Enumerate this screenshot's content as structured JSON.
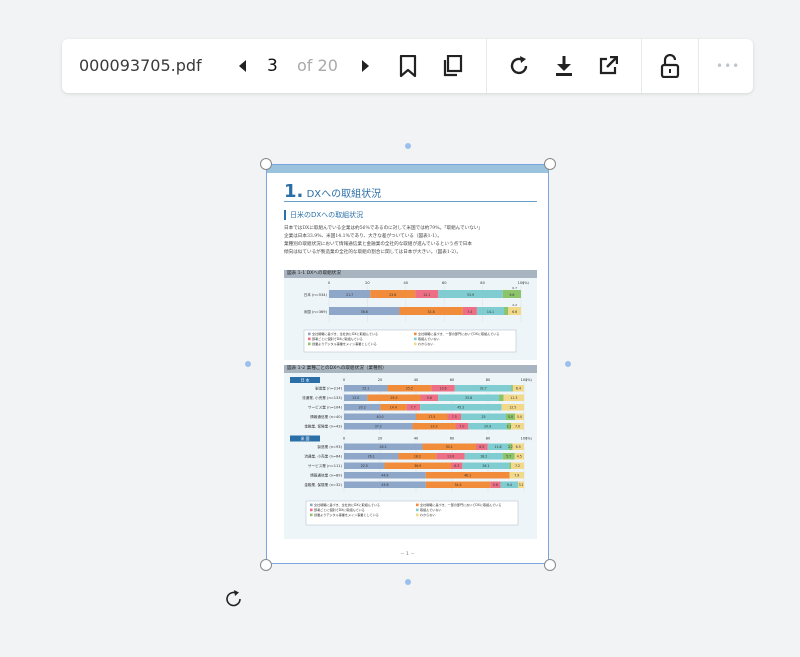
{
  "toolbar": {
    "filename": "000093705.pdf",
    "current_page": "3",
    "page_total": "of 20",
    "more": "•••"
  },
  "document": {
    "chapter_num": "1.",
    "chapter_title": "DXへの取組状況",
    "section_title": "日米のDXへの取組状況",
    "body": [
      "日本ではDXに取組んでいる企業は約56%であるのに対して米国では約79%。「取組んでいない」",
      "企業は日本33.9%、米国14.1%であり、大きな差がついている（図表1-1）。",
      "業種別の取組状況において情報通信業と金融業の全社的な取組が進んでいるという点で日本",
      "傾向は似ているが製造業の全社的な取組の割合に関しては日本が大きい。（図表1-2）。"
    ],
    "footer": "－ 1 －"
  },
  "fig1": {
    "title": "図表 1-1 DXへの取組状況",
    "unit": "(%)",
    "ticks": [
      "0",
      "20",
      "40",
      "60",
      "80",
      "100"
    ],
    "rows": [
      {
        "label": "日本 (n=534)",
        "values": [
          21.7,
          23.6,
          12.1,
          33.9,
          9.6,
          0
        ],
        "labels": [
          "21.7",
          "23.6",
          "12.1",
          "33.9",
          "9.6"
        ],
        "note": "0.7"
      },
      {
        "label": "米国 (n=369)",
        "values": [
          36.6,
          32.8,
          7.4,
          14.1,
          2.2,
          6.6
        ],
        "labels": [
          "36.6",
          "32.8",
          "7.4",
          "14.1",
          "",
          "6.6"
        ],
        "note": "2.2"
      }
    ],
    "legend": [
      "全社戦略に基づき、全社的にDXに取組んでいる",
      "全社戦略に基づき、一部の部門においてDXに取組んでいる",
      "部署ごとに個別でDXに取組んでいる",
      "取組んでいない",
      "創業よりデジタル事業をメイン事業としている",
      "わからない"
    ]
  },
  "fig2": {
    "title": "図表 1-2 業種ごとのDXへの取組状況（業種別）",
    "unit": "(%)",
    "ticks": [
      "0",
      "20",
      "40",
      "60",
      "80",
      "100"
    ],
    "groups": [
      {
        "name": "日 本",
        "rows": [
          {
            "label": "製造業 (n=214)",
            "values": [
              25.1,
              25.2,
              13.6,
              32.7,
              0.8,
              6.4
            ],
            "labels": [
              "25.1",
              "25.2",
              "13.6",
              "32.7",
              "0.8",
              "6.4"
            ]
          },
          {
            "label": "流通業, 小売業 (n=133)",
            "values": [
              13.0,
              29.5,
              9.8,
              33.8,
              2.6,
              11.3
            ],
            "labels": [
              "13.0",
              "29.5",
              "9.8",
              "33.8",
              "",
              "11.3"
            ]
          },
          {
            "label": "サービス業 (n=104)",
            "values": [
              20.2,
              14.4,
              7.7,
              45.2,
              0,
              12.5
            ],
            "labels": [
              "20.2",
              "14.4",
              "7.7",
              "45.2",
              "",
              "12.5"
            ]
          },
          {
            "label": "情報通信業 (n=40)",
            "values": [
              40.0,
              17.5,
              7.5,
              25.0,
              5.0,
              5.0
            ],
            "labels": [
              "40.0",
              "17.5",
              "7.5",
              "25",
              "5.0",
              "5.0"
            ]
          },
          {
            "label": "金融業, 保険業 (n=43)",
            "values": [
              37.2,
              23.3,
              7.0,
              20.9,
              2.3,
              7.0
            ],
            "labels": [
              "37.2",
              "23.3",
              "7.0",
              "20.9",
              "2.3",
              "7.0"
            ]
          }
        ]
      },
      {
        "name": "米 国",
        "rows": [
          {
            "label": "製造業 (n=93)",
            "values": [
              44.1,
              30.1,
              6.5,
              11.8,
              2.2,
              6.5
            ],
            "labels": [
              "44.1",
              "30.1",
              "6.5",
              "11.8",
              "2.2",
              "6.5"
            ]
          },
          {
            "label": "流通業, 小売業 (n=64)",
            "values": [
              26.1,
              18.2,
              13.6,
              18.2,
              5.7,
              4.5
            ],
            "labels": [
              "26.1",
              "18.2",
              "13.6",
              "18.2",
              "5.7",
              "4.5"
            ]
          },
          {
            "label": "サービス業 (n=111)",
            "values": [
              22.5,
              36.9,
              6.3,
              26.1,
              0.9,
              7.2
            ],
            "labels": [
              "22.5",
              "36.9",
              "6.3",
              "26.1",
              "0.9",
              "7.2"
            ]
          },
          {
            "label": "情報通信業 (n=89)",
            "values": [
              44.9,
              46.1,
              0,
              0,
              0,
              7.9
            ],
            "labels": [
              "44.9",
              "46.1",
              "",
              "",
              "",
              "7.9"
            ]
          },
          {
            "label": "金融業, 保険業 (n=32)",
            "values": [
              43.8,
              34.4,
              5.6,
              9.4,
              0,
              3.1
            ],
            "labels": [
              "43.8",
              "34.4",
              "5.6",
              "9.4",
              "",
              "3.1"
            ]
          }
        ]
      }
    ],
    "legend": [
      "全社戦略に基づき、全社的にDXに取組んでいる",
      "全社戦略に基づき、一部の部門においてDXに取組んでいる",
      "部署ごとに個別でDXに取組んでいる",
      "取組んでいない",
      "創業よりデジタル事業をメイン事業としている",
      "わからない"
    ]
  },
  "colors": {
    "series": [
      "#8ea6c8",
      "#f08c3a",
      "#ec6f86",
      "#7fcdd0",
      "#8cc46c",
      "#f2d98a"
    ],
    "accent": "#2b6fa8",
    "selection": "#7aa6e0"
  }
}
